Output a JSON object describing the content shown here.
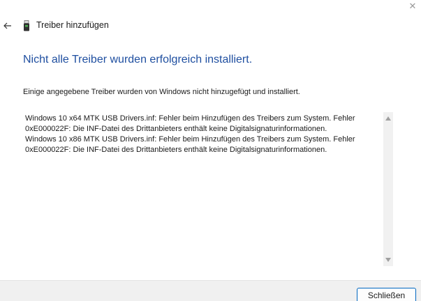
{
  "window": {
    "close_glyph": "✕"
  },
  "titlebar": {
    "back_icon": "back-arrow-icon",
    "device_icon": "usb-device-icon",
    "title": "Treiber hinzufügen"
  },
  "main": {
    "heading": "Nicht alle Treiber wurden erfolgreich installiert.",
    "description": "Einige angegebene Treiber wurden von Windows nicht hinzugefügt und installiert.",
    "details": [
      "Windows 10 x64 MTK USB Drivers.inf: Fehler beim Hinzufügen des Treibers zum System. Fehler 0xE000022F: Die INF-Datei des Drittanbieters enthält keine Digitalsignaturinformationen.",
      "Windows 10 x86 MTK USB Drivers.inf: Fehler beim Hinzufügen des Treibers zum System. Fehler 0xE000022F: Die INF-Datei des Drittanbieters enthält keine Digitalsignaturinformationen."
    ]
  },
  "footer": {
    "close_label": "Schließen"
  },
  "colors": {
    "heading": "#1f4fa0",
    "accent_border": "#0067c0",
    "footer_bg": "#f0f0f0"
  }
}
